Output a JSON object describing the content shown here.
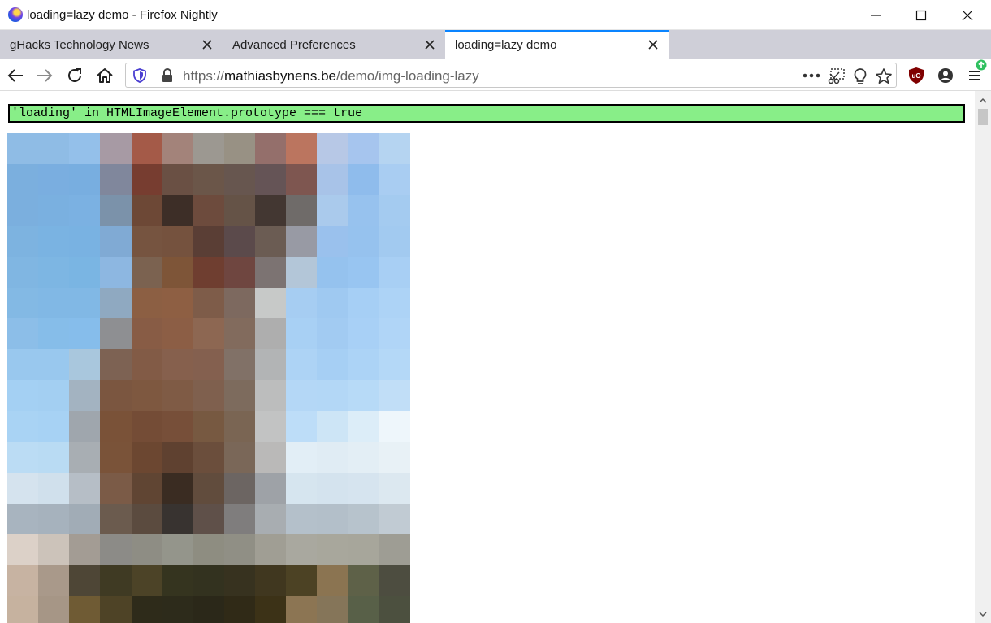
{
  "window": {
    "title": "loading=lazy demo - Firefox Nightly"
  },
  "tabs": [
    {
      "label": "gHacks Technology News"
    },
    {
      "label": "Advanced Preferences"
    },
    {
      "label": "loading=lazy demo"
    }
  ],
  "url": {
    "scheme": "https://",
    "host": "mathiasbynens.be",
    "path": "/demo/img-loading-lazy"
  },
  "page": {
    "check_text": "'loading' in HTMLImageElement.prototype === true"
  },
  "colors": {
    "accent": "#0a84ff",
    "check_bg": "#88ee88"
  },
  "image": {
    "description_colors": [
      [
        "#8fbce5",
        "#8fbce5",
        "#94c0ea",
        "#a79aa4",
        "#a45a48",
        "#a3837a",
        "#9c9891",
        "#989184",
        "#946f6b",
        "#bb755f",
        "#b7c8e6",
        "#a6c5ee",
        "#b5d4f1"
      ],
      [
        "#7bafde",
        "#7aaee0",
        "#78aee0",
        "#80879c",
        "#773d30",
        "#6a5044",
        "#6b5649",
        "#67564f",
        "#655456",
        "#7e5650",
        "#a8c3e8",
        "#8fbcec",
        "#a9cdf2"
      ],
      [
        "#7bafde",
        "#7ab0e0",
        "#7bb1e2",
        "#7b92aa",
        "#6d4836",
        "#3d2e27",
        "#6d4b3d",
        "#655347",
        "#433732",
        "#6f6b69",
        "#aacaec",
        "#97c2ee",
        "#a4cbf0"
      ],
      [
        "#7db3e0",
        "#7ab3e2",
        "#79b2e2",
        "#80aad4",
        "#765440",
        "#75523e",
        "#5a3e35",
        "#5b4a4b",
        "#6b5c53",
        "#989aa4",
        "#9ac1ed",
        "#96c2ee",
        "#a2caf0"
      ],
      [
        "#80b6e2",
        "#7db6e3",
        "#7ab5e3",
        "#8db7e1",
        "#7b6250",
        "#7e5538",
        "#6f3e30",
        "#6f4640",
        "#7c7372",
        "#b3c6d8",
        "#95c2ee",
        "#98c5f1",
        "#a8cff4"
      ],
      [
        "#83b9e4",
        "#81b8e5",
        "#81b8e5",
        "#8fa9c1",
        "#8c5f43",
        "#8e5f43",
        "#7e5c49",
        "#7d695f",
        "#c7c9c8",
        "#a6cdf2",
        "#9fc9f1",
        "#a6cff5",
        "#add3f6"
      ],
      [
        "#8cbee8",
        "#86bde9",
        "#86bdeb",
        "#8e8f92",
        "#885c45",
        "#8c5e45",
        "#8d6752",
        "#826b5d",
        "#aeaeae",
        "#a8d0f4",
        "#a2cbf2",
        "#a8d0f6",
        "#b0d5f7"
      ],
      [
        "#99c8ee",
        "#99c8ee",
        "#a9c7dd",
        "#7d6253",
        "#825b46",
        "#86604d",
        "#84604f",
        "#817167",
        "#b2b4b5",
        "#add3f5",
        "#a6cff4",
        "#acd3f6",
        "#b4d8f7"
      ],
      [
        "#a4d0f3",
        "#a3cff2",
        "#a3b3c1",
        "#7b5640",
        "#7e5840",
        "#7f5b45",
        "#7f604e",
        "#7d6b5d",
        "#bcbdbd",
        "#b4d7f6",
        "#b3d7f6",
        "#b7daf7",
        "#c1def7"
      ],
      [
        "#a9d3f4",
        "#a7d2f4",
        "#9fa6ad",
        "#7a5238",
        "#744c36",
        "#774f39",
        "#775941",
        "#7a6553",
        "#c2c3c3",
        "#bdddf8",
        "#cde5f6",
        "#dcedf8",
        "#eef6fb"
      ],
      [
        "#bbdcf4",
        "#b9dbf3",
        "#a8aeb3",
        "#7a5339",
        "#6c4731",
        "#5f4130",
        "#6b4e3c",
        "#7a6758",
        "#bab9b8",
        "#e2eef6",
        "#e0ecf4",
        "#e3eef5",
        "#e8f1f6"
      ],
      [
        "#d5e3ee",
        "#d0e0ec",
        "#b6bec6",
        "#7b5b47",
        "#604533",
        "#3a2c22",
        "#614c3d",
        "#6c6562",
        "#9ea2a7",
        "#d6e5ef",
        "#d4e3ee",
        "#d6e4ef",
        "#dce8f0"
      ],
      [
        "#a8b4bf",
        "#a6b2bd",
        "#a1acb6",
        "#6b5b4e",
        "#5b4b3f",
        "#383330",
        "#5f5049",
        "#7f7d7d",
        "#a8adb1",
        "#b4c0ca",
        "#b3bfc9",
        "#b7c3cc",
        "#c1cbd3"
      ],
      [
        "#dcd1c8",
        "#ccc3ba",
        "#a39c94",
        "#8c8b87",
        "#8e8d84",
        "#94958b",
        "#8e8d81",
        "#908f85",
        "#a09e94",
        "#a9a89f",
        "#a8a79c",
        "#a7a69b",
        "#9e9d94"
      ],
      [
        "#c7b3a2",
        "#a9998a",
        "#4e4636",
        "#3f3a23",
        "#4c4327",
        "#35341f",
        "#33321f",
        "#37321f",
        "#40371f",
        "#4c4224",
        "#8b7451",
        "#5e6148",
        "#4d4d40"
      ],
      [
        "#c6b29f",
        "#a69686",
        "#6f5b34",
        "#4e4326",
        "#2e2b1a",
        "#2d2b1b",
        "#2b2819",
        "#302a17",
        "#3c3217",
        "#8c7553",
        "#857559",
        "#586048",
        "#4c503f"
      ]
    ]
  }
}
